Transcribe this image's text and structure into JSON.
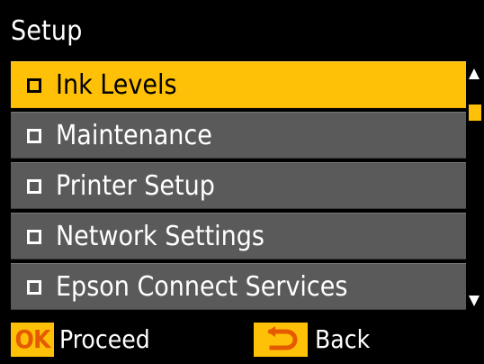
{
  "header": {
    "title": "Setup"
  },
  "menu": {
    "items": [
      {
        "label": "Ink Levels",
        "selected": true
      },
      {
        "label": "Maintenance",
        "selected": false
      },
      {
        "label": "Printer Setup",
        "selected": false
      },
      {
        "label": "Network Settings",
        "selected": false
      },
      {
        "label": "Epson Connect Services",
        "selected": false
      }
    ]
  },
  "footer": {
    "ok_key_label": "OK",
    "ok_action_label": "Proceed",
    "back_key_icon": "back-arrow-icon",
    "back_action_label": "Back"
  },
  "colors": {
    "selection": "#ffc107",
    "item_background": "#5a5a5a",
    "background": "#000000",
    "ok_key_text": "#e55a00"
  }
}
